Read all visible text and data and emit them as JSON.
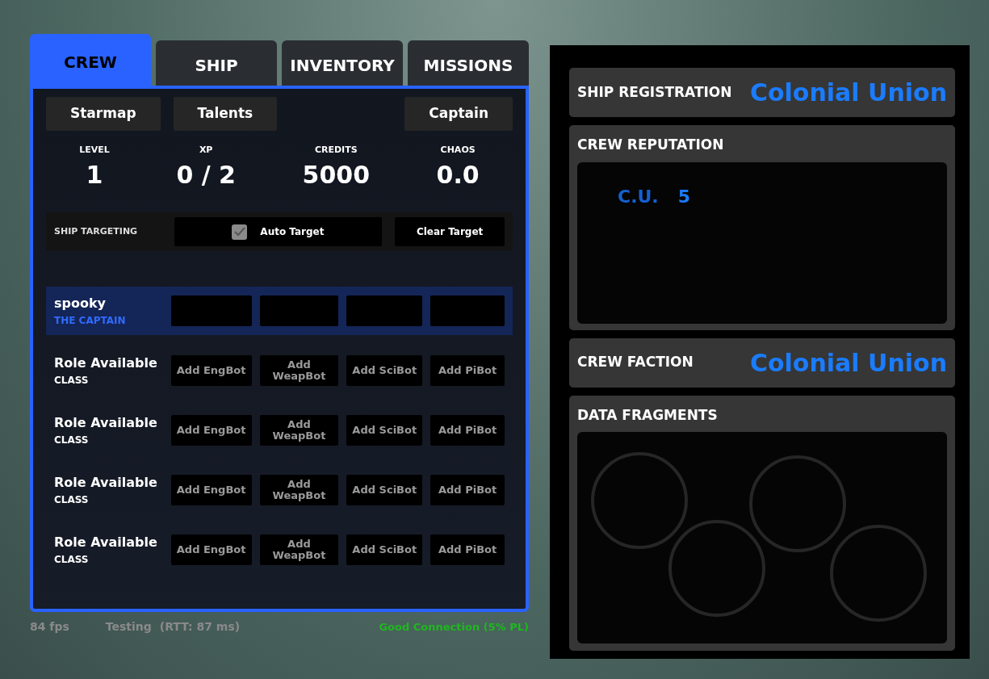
{
  "tabs": [
    {
      "label": "CREW",
      "selected": true
    },
    {
      "label": "SHIP",
      "selected": false
    },
    {
      "label": "INVENTORY",
      "selected": false
    },
    {
      "label": "MISSIONS",
      "selected": false
    }
  ],
  "sub_buttons": [
    "Starmap",
    "Talents",
    "Captain"
  ],
  "stats": [
    {
      "label": "LEVEL",
      "value": "1"
    },
    {
      "label": "XP",
      "value": "0 / 2"
    },
    {
      "label": "CREDITS",
      "value": "5000"
    },
    {
      "label": "CHAOS",
      "value": "0.0"
    }
  ],
  "targeting": {
    "label": "SHIP TARGETING",
    "auto_target": {
      "label": "Auto Target",
      "checked": true
    },
    "clear_button": "Clear Target"
  },
  "crew": [
    {
      "kind": "member",
      "name": "spooky",
      "role": "THE CAPTAIN",
      "selected": true
    },
    {
      "kind": "open",
      "name": "Role Available",
      "role": "CLASS",
      "selected": false,
      "buttons": [
        "Add EngBot",
        "Add WeapBot",
        "Add SciBot",
        "Add PiBot"
      ]
    },
    {
      "kind": "open",
      "name": "Role Available",
      "role": "CLASS",
      "selected": false,
      "buttons": [
        "Add EngBot",
        "Add WeapBot",
        "Add SciBot",
        "Add PiBot"
      ]
    },
    {
      "kind": "open",
      "name": "Role Available",
      "role": "CLASS",
      "selected": false,
      "buttons": [
        "Add EngBot",
        "Add WeapBot",
        "Add SciBot",
        "Add PiBot"
      ]
    },
    {
      "kind": "open",
      "name": "Role Available",
      "role": "CLASS",
      "selected": false,
      "buttons": [
        "Add EngBot",
        "Add WeapBot",
        "Add SciBot",
        "Add PiBot"
      ]
    }
  ],
  "status_bar": {
    "fps": "84 fps",
    "server": "Testing",
    "rtt": "(RTT: 87 ms)",
    "connection": "Good Connection (5% PL)"
  },
  "ship_registration": {
    "label": "SHIP REGISTRATION",
    "value": "Colonial Union"
  },
  "crew_reputation": {
    "title": "CREW REPUTATION",
    "entries": [
      {
        "faction": "C.U.",
        "value": "5"
      }
    ]
  },
  "crew_faction": {
    "label": "CREW FACTION",
    "value": "Colonial Union"
  },
  "data_fragments": {
    "title": "DATA FRAGMENTS"
  }
}
